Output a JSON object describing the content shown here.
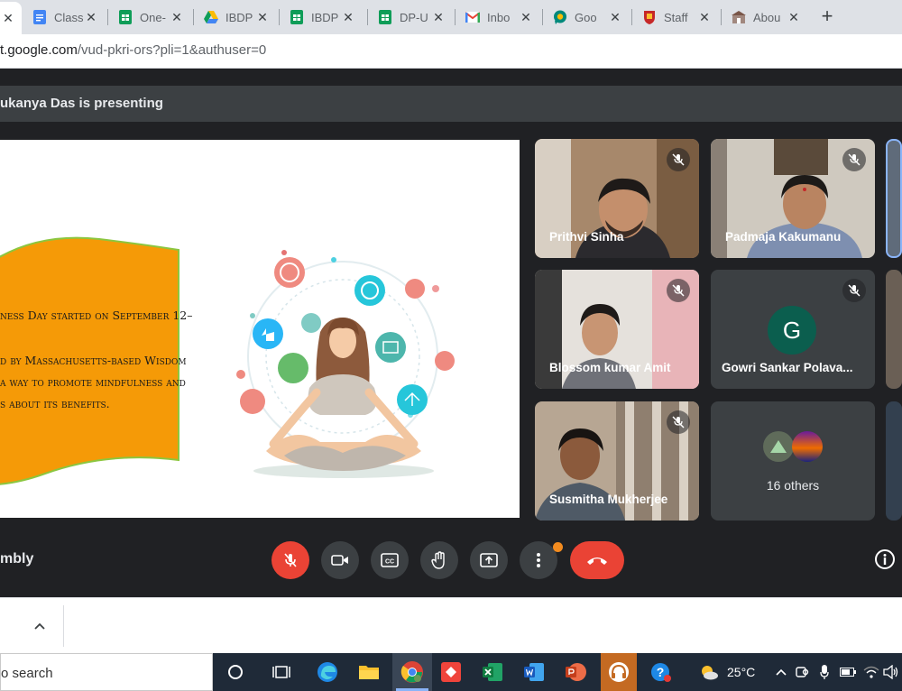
{
  "browser": {
    "tabs": [
      {
        "label": "Class",
        "icon": "google-docs-icon",
        "color": "#4285f4"
      },
      {
        "label": "One-",
        "icon": "google-sheets-icon",
        "color": "#0f9d58"
      },
      {
        "label": "IBDP",
        "icon": "google-drive-icon",
        "color": "#fbbc04"
      },
      {
        "label": "IBDP",
        "icon": "google-sheets-icon",
        "color": "#0f9d58"
      },
      {
        "label": "DP-U",
        "icon": "google-sheets-icon",
        "color": "#0f9d58"
      },
      {
        "label": "Inbo",
        "icon": "gmail-icon",
        "color": "#ea4335"
      },
      {
        "label": "Goo",
        "icon": "google-meet-icon",
        "color": "#00897b"
      },
      {
        "label": "Staff",
        "icon": "school-crest-icon",
        "color": "#c62828"
      },
      {
        "label": "Abou",
        "icon": "school-logo-icon",
        "color": "#795548"
      }
    ],
    "url_main": "t.google.com",
    "url_path": "/vud-pkri-ors?pli=1&authuser=0"
  },
  "meet": {
    "presenting_text": "ukanya Das is presenting",
    "meeting_name": "mbly",
    "slide": {
      "lines": [
        "ness Day started on September 12–",
        "d by Massachusetts-based Wisdom",
        " a way to promote mindfulness and",
        "s about its benefits."
      ]
    },
    "participants": [
      {
        "name": "Prithvi Sinha",
        "muted": true
      },
      {
        "name": "Padmaja Kakumanu",
        "muted": true
      },
      {
        "name": "Blossom kumar Amit",
        "muted": true
      },
      {
        "name": "Gowri Sankar Polava...",
        "muted": true,
        "avatar_letter": "G",
        "avatar_color": "#0b5e4e"
      },
      {
        "name": "Susmitha Mukherjee",
        "muted": true
      }
    ],
    "others_label": "16 others",
    "accent_red": "#ea4335"
  },
  "taskbar": {
    "search_label": "o search",
    "temperature": "25°C"
  }
}
